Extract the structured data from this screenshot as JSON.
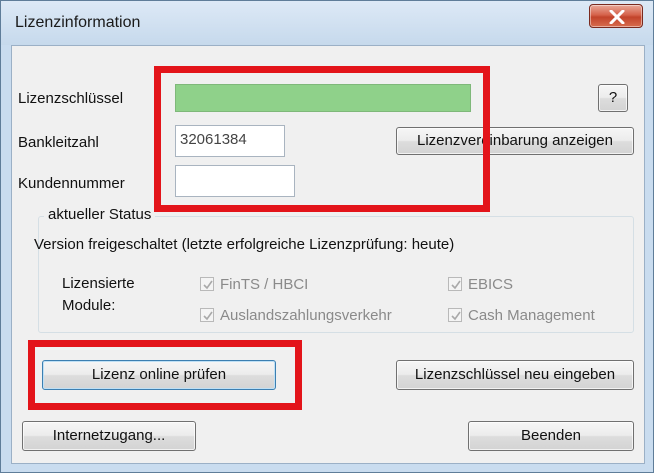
{
  "window": {
    "title": "Lizenzinformation",
    "close_icon": "close-x-icon"
  },
  "fields": {
    "license_key_label": "Lizenzschlüssel",
    "license_key_value": "",
    "bank_code_label": "Bankleitzahl",
    "bank_code_value": "32061384",
    "customer_number_label": "Kundennummer",
    "customer_number_value": ""
  },
  "buttons": {
    "help": "?",
    "show_agreement": "Lizenzvereinbarung anzeigen",
    "check_online": "Lizenz online prüfen",
    "reenter_key": "Lizenzschlüssel neu eingeben",
    "internet_access": "Internetzugang...",
    "quit": "Beenden"
  },
  "status": {
    "group_title": "aktueller Status",
    "message": "Version freigeschaltet (letzte erfolgreiche Lizenzprüfung: heute)",
    "modules_label_line1": "Lizensierte",
    "modules_label_line2": "Module:",
    "modules": [
      {
        "label": "FinTS / HBCI",
        "checked": true
      },
      {
        "label": "EBICS",
        "checked": true
      },
      {
        "label": "Auslandszahlungsverkehr",
        "checked": true
      },
      {
        "label": "Cash Management",
        "checked": true
      }
    ]
  },
  "colors": {
    "license_key_fill": "#8fd18a",
    "highlight": "#e3141a"
  }
}
